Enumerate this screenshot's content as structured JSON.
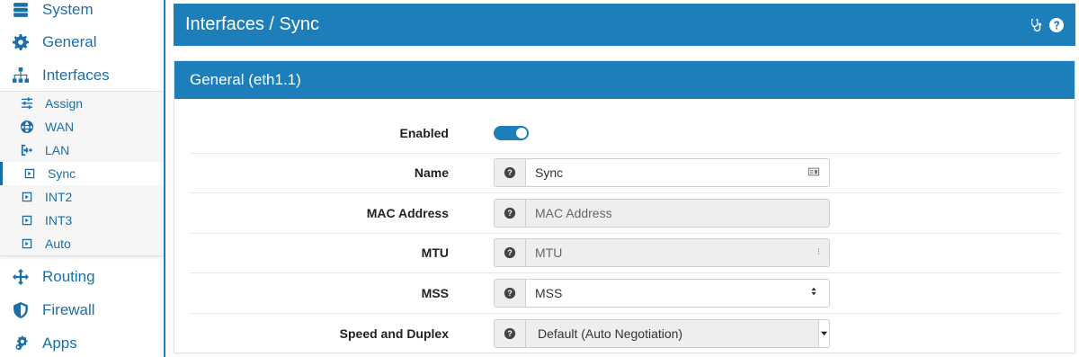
{
  "sidebar": {
    "top_items": [
      {
        "label": "System",
        "icon": "server-icon"
      },
      {
        "label": "General",
        "icon": "gear-icon"
      },
      {
        "label": "Interfaces",
        "icon": "sitemap-icon"
      }
    ],
    "sub_items": [
      {
        "label": "Assign",
        "icon": "sliders-icon"
      },
      {
        "label": "WAN",
        "icon": "globe-icon"
      },
      {
        "label": "LAN",
        "icon": "sign-in-icon"
      },
      {
        "label": "Sync",
        "icon": "interface-icon",
        "active": true
      },
      {
        "label": "INT2",
        "icon": "interface-icon"
      },
      {
        "label": "INT3",
        "icon": "interface-icon"
      },
      {
        "label": "Auto",
        "icon": "interface-icon"
      }
    ],
    "bottom_items": [
      {
        "label": "Routing",
        "icon": "arrows-icon"
      },
      {
        "label": "Firewall",
        "icon": "shield-icon"
      },
      {
        "label": "Apps",
        "icon": "cogs-icon"
      }
    ]
  },
  "header": {
    "title": "Interfaces / Sync",
    "icons": [
      "stethoscope-icon",
      "help-icon"
    ]
  },
  "panel": {
    "title": "General (eth1.1)",
    "fields": {
      "enabled": {
        "label": "Enabled",
        "value": true
      },
      "name": {
        "label": "Name",
        "value": "Sync"
      },
      "mac": {
        "label": "MAC Address",
        "placeholder": "MAC Address"
      },
      "mtu": {
        "label": "MTU",
        "placeholder": "MTU"
      },
      "mss": {
        "label": "MSS",
        "placeholder": "MSS"
      },
      "speed": {
        "label": "Speed and Duplex",
        "value": "Default (Auto Negotiation)"
      }
    }
  },
  "colors": {
    "accent": "#1e7eb9",
    "link": "#1b6fa7"
  }
}
